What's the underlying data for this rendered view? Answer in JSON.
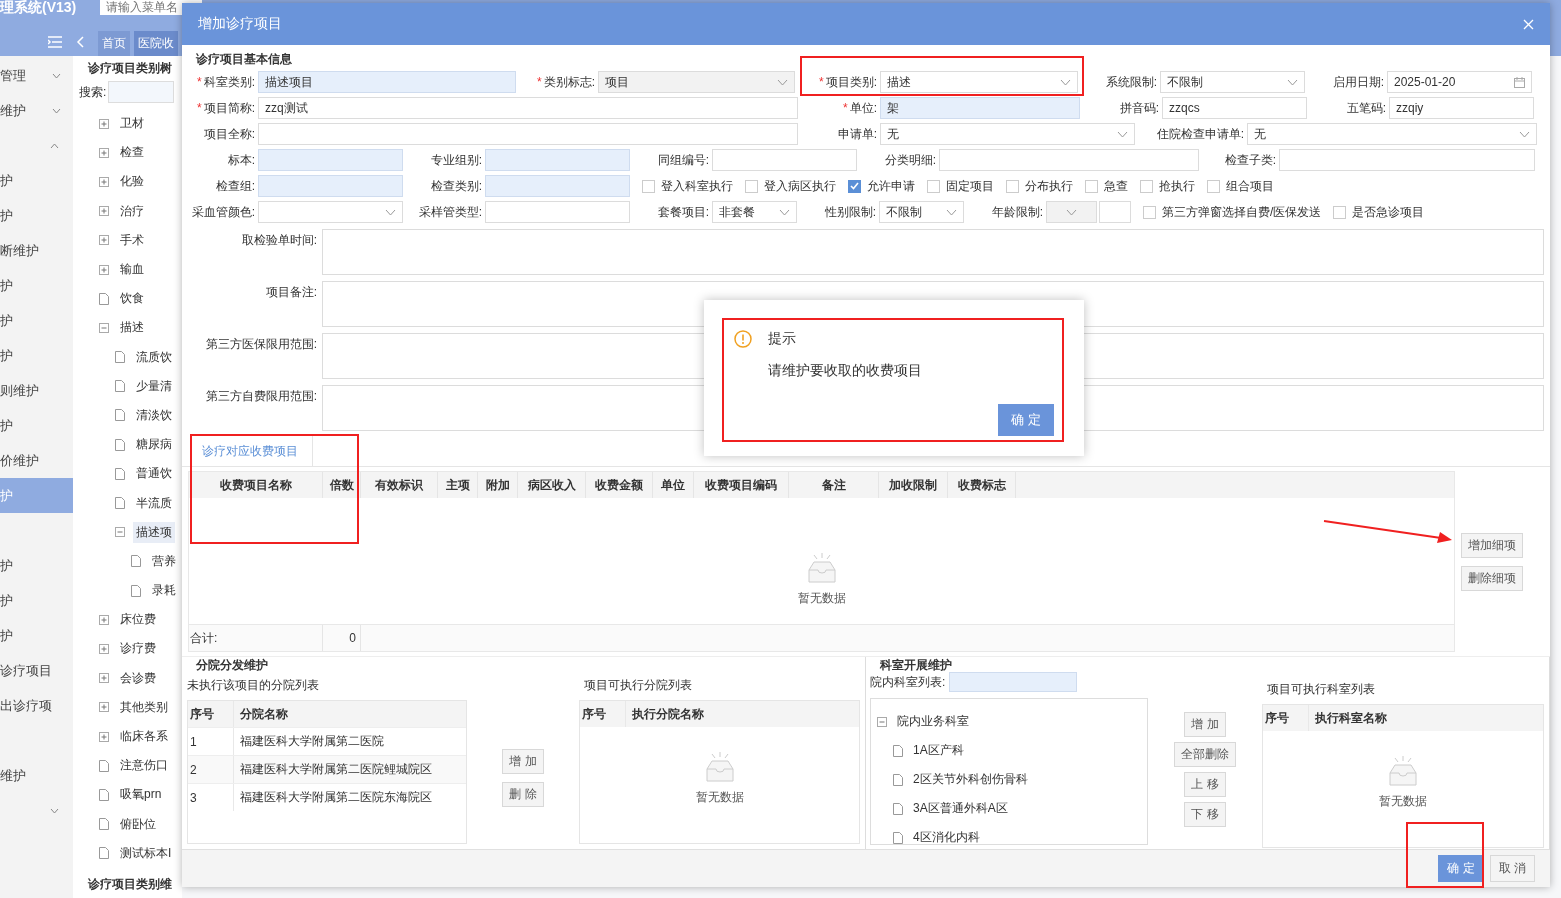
{
  "app": {
    "title": "理系统(V13)",
    "menu_search_placeholder": "请输入菜单名",
    "tabs": [
      {
        "label": "首页",
        "selected": false
      },
      {
        "label": "医院收",
        "selected": true
      }
    ],
    "nav": [
      {
        "kind": "group",
        "label": "管理",
        "expanded": false
      },
      {
        "kind": "group",
        "label": "维护",
        "expanded": false
      },
      {
        "kind": "toggle",
        "expanded": true
      },
      {
        "kind": "item",
        "label": "护",
        "selected": false
      },
      {
        "kind": "item",
        "label": "护",
        "selected": false
      },
      {
        "kind": "item",
        "label": "断维护",
        "selected": false
      },
      {
        "kind": "item",
        "label": "护",
        "selected": false
      },
      {
        "kind": "item",
        "label": "护",
        "selected": false
      },
      {
        "kind": "item",
        "label": "护",
        "selected": false
      },
      {
        "kind": "item",
        "label": "则维护",
        "selected": false
      },
      {
        "kind": "item",
        "label": "护",
        "selected": false
      },
      {
        "kind": "item",
        "label": "价维护",
        "selected": false
      },
      {
        "kind": "item",
        "label": "护",
        "selected": true
      },
      {
        "kind": "spacer"
      },
      {
        "kind": "item",
        "label": "护",
        "selected": false
      },
      {
        "kind": "item",
        "label": "护",
        "selected": false
      },
      {
        "kind": "item",
        "label": "护",
        "selected": false
      },
      {
        "kind": "item",
        "label": "诊疗项目",
        "selected": false
      },
      {
        "kind": "item",
        "label": "出诊疗项",
        "selected": false
      },
      {
        "kind": "spacer"
      },
      {
        "kind": "item",
        "label": "维护",
        "selected": false
      },
      {
        "kind": "toggle",
        "expanded": false
      }
    ]
  },
  "tree": {
    "title": "诊疗项目类别树",
    "search_label": "搜索:",
    "footer_title": "诊疗项目类别维",
    "nodes": [
      {
        "kind": "folder",
        "label": "卫材",
        "expanded": false,
        "selected": false
      },
      {
        "kind": "folder",
        "label": "检查",
        "expanded": false,
        "selected": false
      },
      {
        "kind": "folder",
        "label": "化验",
        "expanded": false,
        "selected": false
      },
      {
        "kind": "folder",
        "label": "治疗",
        "expanded": false,
        "selected": false
      },
      {
        "kind": "folder",
        "label": "手术",
        "expanded": false,
        "selected": false
      },
      {
        "kind": "folder",
        "label": "输血",
        "expanded": false,
        "selected": false
      },
      {
        "kind": "file",
        "label": "饮食",
        "selected": false
      },
      {
        "kind": "folder",
        "label": "描述",
        "expanded": true,
        "selected": false,
        "children": [
          {
            "kind": "file",
            "label": "流质饮",
            "selected": false
          },
          {
            "kind": "file",
            "label": "少量清",
            "selected": false
          },
          {
            "kind": "file",
            "label": "清淡饮",
            "selected": false
          },
          {
            "kind": "file",
            "label": "糖尿病",
            "selected": false
          },
          {
            "kind": "file",
            "label": "普通饮",
            "selected": false
          },
          {
            "kind": "file",
            "label": "半流质",
            "selected": false
          },
          {
            "kind": "folder",
            "label": "描述项",
            "expanded": true,
            "selected": true,
            "children": [
              {
                "kind": "file",
                "label": "营养",
                "selected": false
              },
              {
                "kind": "file",
                "label": "录耗",
                "selected": false
              }
            ]
          }
        ]
      },
      {
        "kind": "folder",
        "label": "床位费",
        "expanded": false,
        "selected": false
      },
      {
        "kind": "folder",
        "label": "诊疗费",
        "expanded": false,
        "selected": false
      },
      {
        "kind": "folder",
        "label": "会诊费",
        "expanded": false,
        "selected": false
      },
      {
        "kind": "folder",
        "label": "其他类别",
        "expanded": false,
        "selected": false
      },
      {
        "kind": "folder",
        "label": "临床各系",
        "expanded": false,
        "selected": false
      },
      {
        "kind": "file",
        "label": "注意伤口",
        "selected": false
      },
      {
        "kind": "file",
        "label": "吸氧prn",
        "selected": false
      },
      {
        "kind": "file",
        "label": "俯卧位",
        "selected": false
      },
      {
        "kind": "file",
        "label": "测试标本I",
        "selected": false
      }
    ]
  },
  "dialog": {
    "title": "增加诊疗项目",
    "basic_info": {
      "title": "诊疗项目基本信息",
      "rows": [
        {
          "fields": [
            {
              "kind": "input",
              "required_mark": "*",
              "label": "科室类别:",
              "readonly": true,
              "value": "描述项目"
            },
            {
              "kind": "select",
              "required_mark": "*",
              "label": "类别标志:",
              "disabled": true,
              "value": "项目"
            },
            {
              "kind": "select",
              "required_mark": "*",
              "label": "项目类别:",
              "disabled": false,
              "value": "描述"
            },
            {
              "kind": "select",
              "label": "系统限制:",
              "disabled": false,
              "value": "不限制"
            },
            {
              "kind": "date",
              "label": "启用日期:",
              "value": "2025-01-20"
            }
          ]
        },
        {
          "fields": [
            {
              "kind": "input",
              "required_mark": "*",
              "label": "项目简称:",
              "readonly": false,
              "value": "zzq测试"
            },
            {
              "kind": "input",
              "required_mark": "*",
              "label": "单位:",
              "readonly": true,
              "value": "架"
            },
            {
              "kind": "input",
              "label": "拼音码:",
              "readonly": false,
              "value": "zzqcs"
            },
            {
              "kind": "input",
              "label": "五笔码:",
              "readonly": false,
              "value": "zzqiy"
            }
          ]
        },
        {
          "fields": [
            {
              "kind": "input",
              "label": "项目全称:",
              "readonly": false
            },
            {
              "kind": "select",
              "label": "申请单:",
              "disabled": false,
              "value": "无"
            },
            {
              "kind": "select",
              "label": "住院检查申请单:",
              "disabled": false,
              "value": "无"
            }
          ]
        },
        {
          "fields": [
            {
              "kind": "input",
              "label": "标本:",
              "readonly": true
            },
            {
              "kind": "input",
              "label": "专业组别:",
              "readonly": true
            },
            {
              "kind": "input",
              "label": "同组编号:",
              "readonly": false
            },
            {
              "kind": "input",
              "label": "分类明细:",
              "readonly": false
            },
            {
              "kind": "input",
              "label": "检查子类:",
              "readonly": false
            }
          ]
        },
        {
          "fields": [
            {
              "kind": "input",
              "label": "检查组:",
              "readonly": true
            },
            {
              "kind": "input",
              "label": "检查类别:",
              "readonly": true
            },
            {
              "kind": "checkbox",
              "label": "登入科室执行",
              "checked": false
            },
            {
              "kind": "checkbox",
              "label": "登入病区执行",
              "checked": false
            },
            {
              "kind": "checkbox",
              "label": "允许申请",
              "checked": true
            },
            {
              "kind": "checkbox",
              "label": "固定项目",
              "checked": false
            },
            {
              "kind": "checkbox",
              "label": "分布执行",
              "checked": false
            },
            {
              "kind": "checkbox",
              "label": "急查",
              "checked": false
            },
            {
              "kind": "checkbox",
              "label": "抢执行",
              "checked": false
            },
            {
              "kind": "checkbox",
              "label": "组合项目",
              "checked": false
            }
          ]
        },
        {
          "fields": [
            {
              "kind": "select",
              "label": "采血管颜色:",
              "disabled": false
            },
            {
              "kind": "input",
              "label": "采样管类型:",
              "readonly": false
            },
            {
              "kind": "select",
              "label": "套餐项目:",
              "disabled": false,
              "value": "非套餐"
            },
            {
              "kind": "select",
              "label": "性别限制:",
              "disabled": false,
              "value": "不限制"
            },
            {
              "kind": "range",
              "label": "年龄限制:"
            },
            {
              "kind": "checkbox",
              "label": "第三方弹窗选择自费/医保发送",
              "checked": false
            },
            {
              "kind": "checkbox",
              "label": "是否急诊项目",
              "checked": false
            }
          ]
        }
      ],
      "textareas": [
        {
          "label": "取检验单时间:"
        },
        {
          "label": "项目备注:"
        },
        {
          "label": "第三方医保限用范围:"
        },
        {
          "label": "第三方自费限用范围:"
        }
      ]
    },
    "charges": {
      "tabs": [
        {
          "label": "诊疗对应收费项目",
          "selected": true
        }
      ],
      "columns": [
        "收费项目名称",
        "倍数",
        "有效标识",
        "主项",
        "附加",
        "病区收入",
        "收费金额",
        "单位",
        "收费项目编码",
        "备注",
        "加收限制",
        "收费标志"
      ],
      "empty_text": "暂无数据",
      "total_label": "合计:",
      "total_value": "0",
      "buttons": [
        "增加细项",
        "删除细项"
      ]
    },
    "branches": {
      "title": "分院分发维护",
      "available": {
        "title": "未执行该项目的分院列表",
        "columns": [
          "序号",
          "分院名称"
        ],
        "rows": [
          [
            "1",
            "福建医科大学附属第二医院"
          ],
          [
            "2",
            "福建医科大学附属第二医院鲤城院区"
          ],
          [
            "3",
            "福建医科大学附属第二医院东海院区"
          ]
        ]
      },
      "buttons": [
        "增 加",
        "删 除"
      ],
      "assigned": {
        "title": "项目可执行分院列表",
        "columns": [
          "序号",
          "执行分院名称"
        ],
        "empty_text": "暂无数据"
      }
    },
    "departments": {
      "title": "科室开展维护",
      "search_label": "院内科室列表:",
      "tree": {
        "label": "院内业务科室",
        "expanded": true,
        "children": [
          {
            "label": "1A区产科"
          },
          {
            "label": "2区关节外科创伤骨科"
          },
          {
            "label": "3A区普通外科A区"
          },
          {
            "label": "4区消化内科"
          }
        ]
      },
      "buttons": [
        "增 加",
        "全部删除",
        "上 移",
        "下 移"
      ],
      "assigned": {
        "title": "项目可执行科室列表",
        "columns": [
          "序号",
          "执行科室名称"
        ],
        "empty_text": "暂无数据"
      }
    },
    "footer_buttons": [
      {
        "kind": "primary",
        "label": "确 定"
      },
      {
        "kind": "default",
        "label": "取 消"
      }
    ]
  },
  "alert": {
    "title": "提示",
    "message": "请维护要收取的收费项目",
    "button": "确 定"
  }
}
